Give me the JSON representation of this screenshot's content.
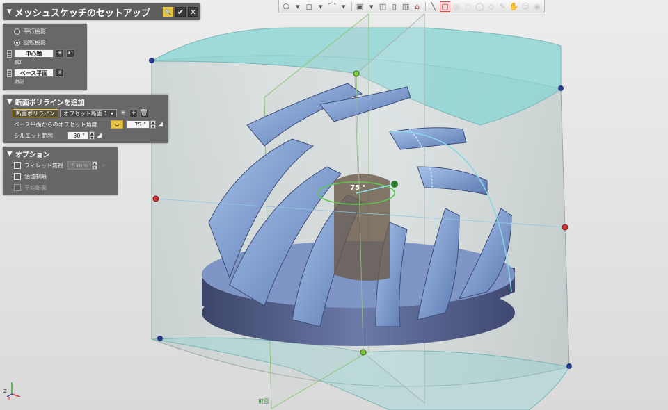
{
  "title": "メッシュスケッチのセットアップ",
  "projection": {
    "options": [
      "平行投影",
      "回転投影"
    ],
    "selected": 1,
    "center_axis": {
      "label": "中心軸",
      "value": "軸1"
    },
    "base_plane": {
      "label": "ベース平面",
      "value": "前面"
    }
  },
  "add_section": {
    "title": "断面ポリラインを追加",
    "polyline_label": "断面ポリライン",
    "offset_select": "オフセット断面 1",
    "offset_angle_label": "ベース平面からのオフセット角度",
    "offset_angle_value": "75 °",
    "silhouette_label": "シルエット範囲",
    "silhouette_value": "30 °"
  },
  "options": {
    "title": "オプション",
    "fillet_label": "フィレット無視",
    "fillet_value": "5 mm",
    "region_label": "領域制限",
    "average_label": "平均断面"
  },
  "viewport": {
    "angle_annotation": "75 °",
    "plane_label": "前面",
    "axis_labels": [
      "Z",
      "X"
    ]
  },
  "colors": {
    "panel": "#5e5e5e",
    "highlight": "#e8c444",
    "plane_fill": "#86d4d4",
    "mesh": "#6f8fc4",
    "handle_green": "#7ec83a",
    "handle_red": "#d33333",
    "handle_blue": "#2a3a8a"
  }
}
